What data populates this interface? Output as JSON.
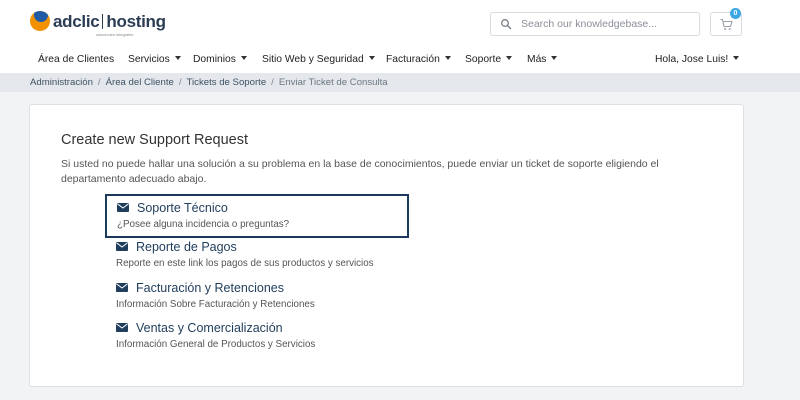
{
  "brand": {
    "name_left": "adclic",
    "name_right": "hosting",
    "tagline": "soluciones integrales"
  },
  "search": {
    "placeholder": "Search our knowledgebase..."
  },
  "cart": {
    "count": "0"
  },
  "nav": {
    "items": [
      {
        "label": "Área de Clientes",
        "dropdown": false
      },
      {
        "label": "Servicios",
        "dropdown": true
      },
      {
        "label": "Dominios",
        "dropdown": true
      },
      {
        "label": "Sitio Web y Seguridad",
        "dropdown": true
      },
      {
        "label": "Facturación",
        "dropdown": true
      },
      {
        "label": "Soporte",
        "dropdown": true
      },
      {
        "label": "Más",
        "dropdown": true
      }
    ],
    "user": "Hola, Jose Luis!"
  },
  "breadcrumb": {
    "items": [
      "Administración",
      "Área del Cliente",
      "Tickets de Soporte",
      "Enviar Ticket de Consulta"
    ],
    "separator": "/"
  },
  "main": {
    "title": "Create new Support Request",
    "description": "Si usted no puede hallar una solución a su problema en la base de conocimientos, puede enviar un ticket de soporte eligiendo el departamento adecuado abajo.",
    "departments": [
      {
        "name": "Soporte Técnico",
        "description": "¿Posee alguna incidencia o preguntas?",
        "icon": "envelope-icon",
        "selected": true
      },
      {
        "name": "Reporte de Pagos",
        "description": "Reporte en este link los pagos de sus productos y servicios",
        "icon": "envelope-icon",
        "selected": false
      },
      {
        "name": "Facturación y Retenciones",
        "description": "Información Sobre Facturación y Retenciones",
        "icon": "envelope-icon",
        "selected": false
      },
      {
        "name": "Ventas y Comercialización",
        "description": "Información General de Productos y Servicios",
        "icon": "envelope-icon",
        "selected": false
      }
    ]
  },
  "colors": {
    "brand_orange": "#f39200",
    "brand_blue": "#1f5aa6",
    "link_dark": "#1f3d5c",
    "badge": "#3ba7e3",
    "breadcrumb_bg": "#e4e7ec"
  }
}
